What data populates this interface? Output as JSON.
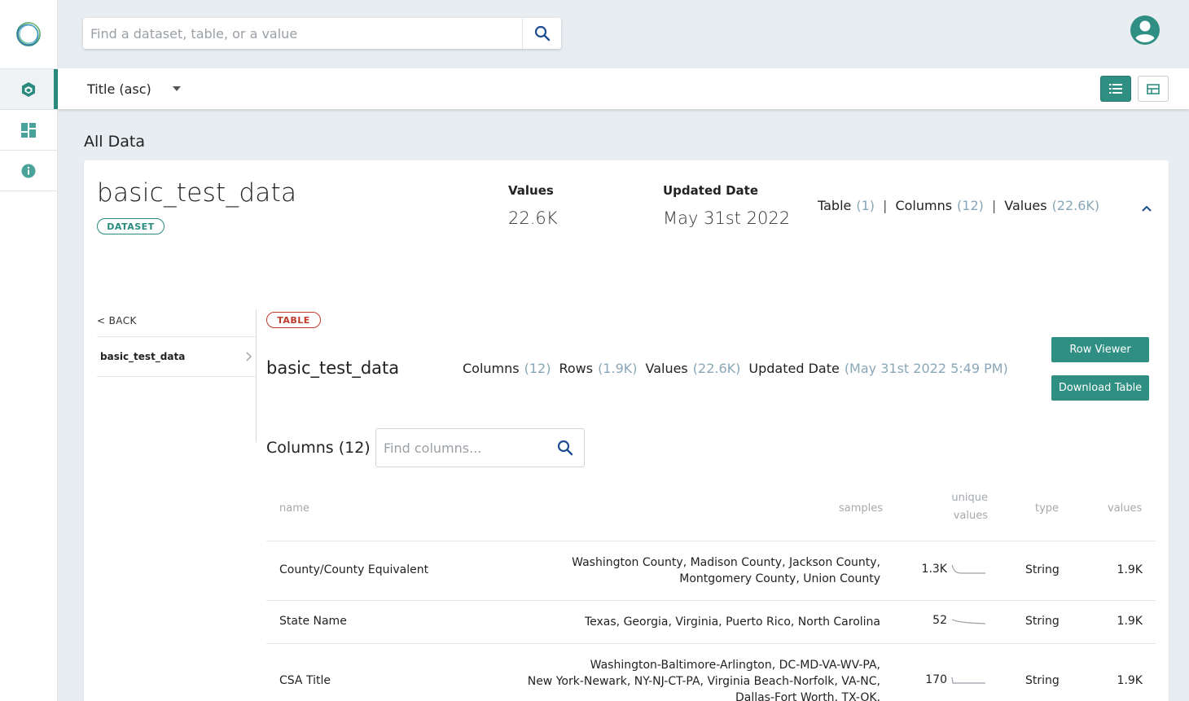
{
  "search": {
    "placeholder": "Find a dataset, table, or a value"
  },
  "sort": {
    "label": "Title (asc)"
  },
  "section_title": "All Data",
  "dataset": {
    "name": "basic_test_data",
    "badge": "DATASET",
    "values_label": "Values",
    "values": "22.6K",
    "updated_label": "Updated Date",
    "updated": "May 31st 2022",
    "summary": [
      {
        "label": "Table",
        "count": "(1)"
      },
      {
        "label": "Columns",
        "count": "(12)"
      },
      {
        "label": "Values",
        "count": "(22.6K)"
      }
    ]
  },
  "tree": {
    "back_label": "< BACK",
    "items": [
      {
        "label": "basic_test_data"
      }
    ]
  },
  "table": {
    "badge": "TABLE",
    "name": "basic_test_data",
    "stats": {
      "columns_label": "Columns",
      "columns": "(12)",
      "rows_label": "Rows",
      "rows": "(1.9K)",
      "values_label": "Values",
      "values": "(22.6K)",
      "updated_label": "Updated Date",
      "updated": "(May 31st 2022 5:49 PM)"
    },
    "row_viewer_label": "Row Viewer",
    "download_label": "Download Table"
  },
  "columns_section": {
    "title": "Columns (12)",
    "search_placeholder": "Find columns...",
    "headers": {
      "name": "name",
      "samples": "samples",
      "unique_line1": "unique",
      "unique_line2": "values",
      "type": "type",
      "values": "values"
    },
    "rows": [
      {
        "name": "County/County Equivalent",
        "samples_line1": "Washington County, Madison County, Jackson County,",
        "samples_line2": "Montgomery County, Union County",
        "samples_line3": "",
        "unique": "1.3K",
        "type": "String",
        "values": "1.9K"
      },
      {
        "name": "State Name",
        "samples_line1": "Texas, Georgia, Virginia, Puerto Rico, North Carolina",
        "samples_line2": "",
        "samples_line3": "",
        "unique": "52",
        "type": "String",
        "values": "1.9K"
      },
      {
        "name": "CSA Title",
        "samples_line1": "Washington-Baltimore-Arlington, DC-MD-VA-WV-PA,",
        "samples_line2": "New York-Newark, NY-NJ-CT-PA, Virginia Beach-Norfolk, VA-NC,",
        "samples_line3": "Dallas-Fort Worth, TX-OK,",
        "unique": "170",
        "type": "String",
        "values": "1.9K"
      }
    ]
  },
  "colors": {
    "accent": "#2f8f82",
    "table_badge": "#c0392b",
    "muted": "#8aa7b8"
  }
}
